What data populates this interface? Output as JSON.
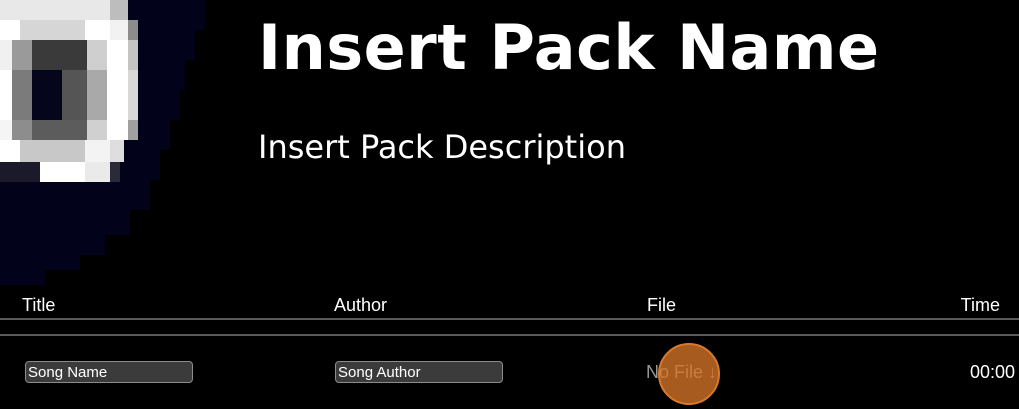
{
  "pack": {
    "name": "Insert Pack Name",
    "description": "Insert Pack Description"
  },
  "cover_art": {
    "icon": "pixelated-disc-art",
    "background_color": "#02021a",
    "ring_color": "#f4f4f4",
    "shade_color": "#8a8a8a"
  },
  "table": {
    "headers": {
      "title": "Title",
      "author": "Author",
      "file": "File",
      "time": "Time"
    },
    "rows": [
      {
        "title_placeholder": "Song Name",
        "author_placeholder": "Song Author",
        "file": "No File ↓",
        "time": "00:00"
      }
    ]
  },
  "colors": {
    "background": "#000000",
    "text": "#ffffff",
    "muted_text": "#9a9a9a",
    "rule": "#5a5a5a",
    "input_background": "#3b3b3b",
    "highlight": "#d77a2e"
  }
}
